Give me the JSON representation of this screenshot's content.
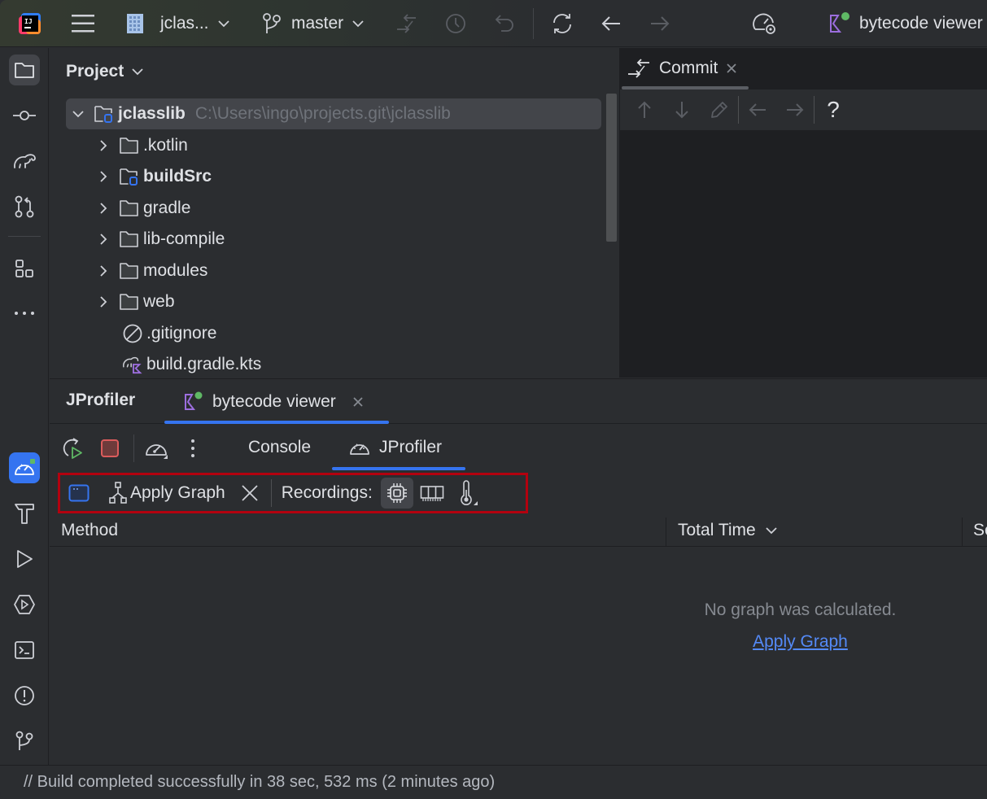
{
  "titlebar": {
    "project_name": "jclas...",
    "branch": "master",
    "run_config": "bytecode viewer"
  },
  "toolstrip": {
    "top": [
      "project",
      "commit",
      "gradle",
      "pull-requests",
      "structure",
      "more"
    ],
    "bottom": [
      "jprofiler",
      "build",
      "run",
      "services",
      "terminal",
      "problems",
      "git"
    ]
  },
  "project_panel": {
    "title": "Project",
    "tree": [
      {
        "name": "jclasslib",
        "path": "C:\\Users\\ingo\\projects.git\\jclasslib",
        "type": "module",
        "expanded": true,
        "bold": true,
        "selected": true,
        "level": 0
      },
      {
        "name": ".kotlin",
        "type": "folder",
        "expanded": false,
        "level": 1
      },
      {
        "name": "buildSrc",
        "type": "module",
        "expanded": false,
        "bold": true,
        "level": 1
      },
      {
        "name": "gradle",
        "type": "folder",
        "expanded": false,
        "level": 1
      },
      {
        "name": "lib-compile",
        "type": "folder",
        "expanded": false,
        "level": 1
      },
      {
        "name": "modules",
        "type": "folder",
        "expanded": false,
        "level": 1
      },
      {
        "name": "web",
        "type": "folder",
        "expanded": false,
        "level": 1
      },
      {
        "name": ".gitignore",
        "type": "ignore-file",
        "level": 1
      },
      {
        "name": "build.gradle.kts",
        "type": "gradle-kts",
        "level": 1
      }
    ]
  },
  "commit_panel": {
    "tab_label": "Commit",
    "help_label": "?"
  },
  "bottom_panel": {
    "title": "JProfiler",
    "tab_label": "bytecode viewer",
    "run_tabs": [
      "Console",
      "JProfiler"
    ],
    "active_run_tab": "JProfiler",
    "profiler_toolbar": {
      "apply_graph_label": "Apply Graph",
      "recordings_label": "Recordings:",
      "recordings": [
        "cpu",
        "memory",
        "telemetry"
      ],
      "selected_recording": "cpu"
    },
    "table": {
      "columns": [
        "Method",
        "Total Time",
        "Se"
      ],
      "sort_column": "Total Time"
    },
    "empty_message": "No graph was calculated.",
    "empty_link": "Apply Graph"
  },
  "statusbar": {
    "text": "// Build completed successfully in 38 sec, 532 ms (2 minutes ago)"
  },
  "colors": {
    "accent": "#3574f0",
    "link": "#548af7",
    "highlight_border": "#b3000f",
    "stop": "#db5c5c",
    "run": "#5fb865",
    "kotlin": "#9c6ede",
    "status_dot": "#5fb865",
    "module_badge": "#3574f0"
  }
}
